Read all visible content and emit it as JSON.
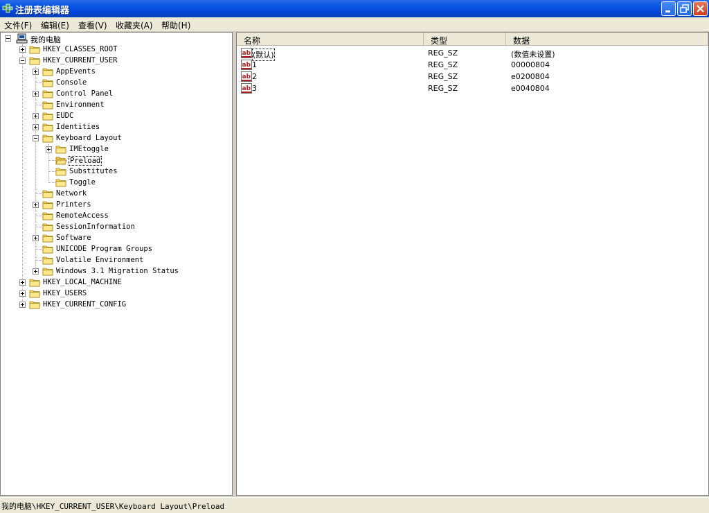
{
  "window": {
    "title": "注册表编辑器"
  },
  "menu": [
    {
      "label": "文件(F)"
    },
    {
      "label": "编辑(E)"
    },
    {
      "label": "查看(V)"
    },
    {
      "label": "收藏夹(A)"
    },
    {
      "label": "帮助(H)"
    }
  ],
  "tree": {
    "root": "我的电脑",
    "nodes": [
      {
        "label": "HKEY_CLASSES_ROOT"
      },
      {
        "label": "HKEY_CURRENT_USER"
      },
      {
        "label": "AppEvents"
      },
      {
        "label": "Console"
      },
      {
        "label": "Control Panel"
      },
      {
        "label": "Environment"
      },
      {
        "label": "EUDC"
      },
      {
        "label": "Identities"
      },
      {
        "label": "Keyboard Layout"
      },
      {
        "label": "IMEtoggle"
      },
      {
        "label": "Preload"
      },
      {
        "label": "Substitutes"
      },
      {
        "label": "Toggle"
      },
      {
        "label": "Network"
      },
      {
        "label": "Printers"
      },
      {
        "label": "RemoteAccess"
      },
      {
        "label": "SessionInformation"
      },
      {
        "label": "Software"
      },
      {
        "label": "UNICODE Program Groups"
      },
      {
        "label": "Volatile Environment"
      },
      {
        "label": "Windows 3.1 Migration Status"
      },
      {
        "label": "HKEY_LOCAL_MACHINE"
      },
      {
        "label": "HKEY_USERS"
      },
      {
        "label": "HKEY_CURRENT_CONFIG"
      }
    ]
  },
  "list": {
    "columns": [
      "名称",
      "类型",
      "数据"
    ],
    "rows": [
      {
        "name": "(默认)",
        "type": "REG_SZ",
        "data": "(数值未设置)"
      },
      {
        "name": "1",
        "type": "REG_SZ",
        "data": "00000804"
      },
      {
        "name": "2",
        "type": "REG_SZ",
        "data": "e0200804"
      },
      {
        "name": "3",
        "type": "REG_SZ",
        "data": "e0040804"
      }
    ]
  },
  "status": {
    "path": "我的电脑\\HKEY_CURRENT_USER\\Keyboard Layout\\Preload"
  },
  "colors": {
    "titlebar": "#0a58e4",
    "close": "#c8401c",
    "folder": "#f8d860"
  },
  "icons": {
    "app": "regedit-icon",
    "computer": "computer-icon",
    "folder": "folder-icon",
    "value": "string-value-icon"
  }
}
